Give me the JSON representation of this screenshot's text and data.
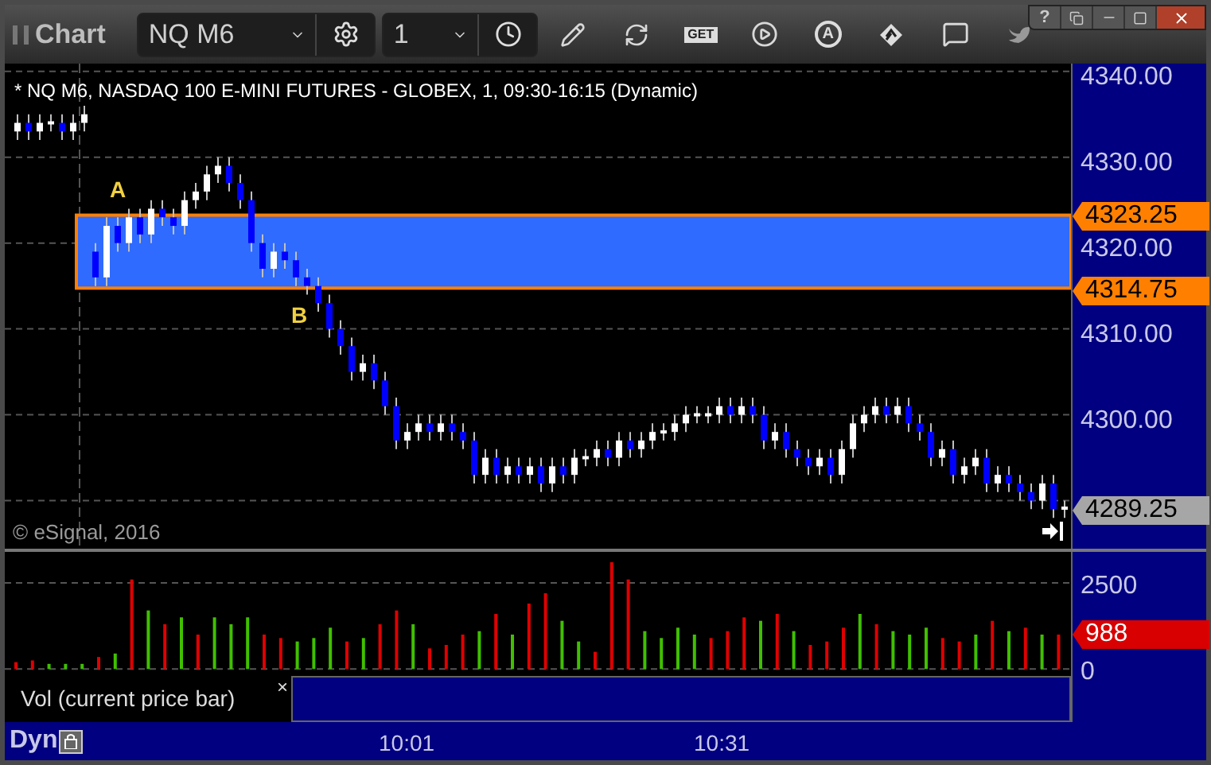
{
  "window": {
    "title": "Chart",
    "help": "?"
  },
  "toolbar": {
    "symbol": "NQ M6",
    "interval": "1",
    "get_label": "GET",
    "auto_label": "A"
  },
  "chart": {
    "title": "* NQ M6, NASDAQ 100 E-MINI FUTURES - GLOBEX, 1, 09:30-16:15 (Dynamic)",
    "copyright": "© eSignal, 2016",
    "zone_labels": [
      "A",
      "B"
    ],
    "price_tags": [
      {
        "text": "4323.25",
        "color": "#ff8000"
      },
      {
        "text": "4314.75",
        "color": "#ff8000"
      },
      {
        "text": "4289.25",
        "color": "#a6a6a6"
      }
    ],
    "chart_data": {
      "type": "candlestick",
      "ylim": [
        4284.4,
        4340.9
      ],
      "grid": true,
      "yticks": [
        {
          "value": 4340,
          "label": "4340.00"
        },
        {
          "value": 4330,
          "label": "4330.00"
        },
        {
          "value": 4320,
          "label": "4320.00"
        },
        {
          "value": 4310,
          "label": "4310.00"
        },
        {
          "value": 4300,
          "label": "4300.00"
        }
      ],
      "ohlc": [
        [
          4333,
          4335,
          4332,
          4334
        ],
        [
          4334,
          4335,
          4332,
          4333
        ],
        [
          4333,
          4335,
          4332,
          4334
        ],
        [
          4334,
          4335,
          4333,
          4334
        ],
        [
          4334,
          4335,
          4332,
          4333
        ],
        [
          4333,
          4335,
          4332,
          4334
        ],
        [
          4334,
          4336,
          4333,
          4335
        ],
        [
          4319,
          4320,
          4315,
          4316
        ],
        [
          4316,
          4323,
          4315,
          4322
        ],
        [
          4322,
          4323,
          4319,
          4320
        ],
        [
          4320,
          4324,
          4319,
          4323
        ],
        [
          4323,
          4324,
          4320,
          4321
        ],
        [
          4321,
          4325,
          4320,
          4324
        ],
        [
          4324,
          4325,
          4322,
          4323
        ],
        [
          4323,
          4324,
          4321,
          4322
        ],
        [
          4322,
          4326,
          4321,
          4325
        ],
        [
          4325,
          4327,
          4324,
          4326
        ],
        [
          4326,
          4329,
          4325,
          4328
        ],
        [
          4328,
          4330,
          4327,
          4329
        ],
        [
          4329,
          4330,
          4326,
          4327
        ],
        [
          4327,
          4328,
          4324,
          4325
        ],
        [
          4325,
          4326,
          4319,
          4320
        ],
        [
          4320,
          4321,
          4316,
          4317
        ],
        [
          4317,
          4320,
          4316,
          4319
        ],
        [
          4319,
          4320,
          4317,
          4318
        ],
        [
          4318,
          4319,
          4315,
          4316
        ],
        [
          4316,
          4317,
          4314,
          4315
        ],
        [
          4315,
          4316,
          4312,
          4313
        ],
        [
          4313,
          4314,
          4309,
          4310
        ],
        [
          4310,
          4311,
          4307,
          4308
        ],
        [
          4308,
          4309,
          4304,
          4305
        ],
        [
          4305,
          4307,
          4304,
          4306
        ],
        [
          4306,
          4307,
          4303,
          4304
        ],
        [
          4304,
          4305,
          4300,
          4301
        ],
        [
          4301,
          4302,
          4296,
          4297
        ],
        [
          4297,
          4299,
          4296,
          4298
        ],
        [
          4298,
          4300,
          4297,
          4299
        ],
        [
          4299,
          4300,
          4297,
          4298
        ],
        [
          4298,
          4300,
          4297,
          4299
        ],
        [
          4299,
          4300,
          4297,
          4298
        ],
        [
          4298,
          4299,
          4296,
          4297
        ],
        [
          4297,
          4298,
          4292,
          4293
        ],
        [
          4293,
          4296,
          4292,
          4295
        ],
        [
          4295,
          4296,
          4292,
          4293
        ],
        [
          4293,
          4295,
          4292,
          4294
        ],
        [
          4294,
          4295,
          4292,
          4293
        ],
        [
          4293,
          4295,
          4292,
          4294
        ],
        [
          4294,
          4295,
          4291,
          4292
        ],
        [
          4292,
          4295,
          4291,
          4294
        ],
        [
          4294,
          4295,
          4292,
          4293
        ],
        [
          4293,
          4296,
          4292,
          4295
        ],
        [
          4295,
          4296,
          4294,
          4295
        ],
        [
          4295,
          4297,
          4294,
          4296
        ],
        [
          4296,
          4297,
          4294,
          4295
        ],
        [
          4295,
          4298,
          4294,
          4297
        ],
        [
          4297,
          4298,
          4295,
          4296
        ],
        [
          4296,
          4298,
          4295,
          4297
        ],
        [
          4297,
          4299,
          4296,
          4298
        ],
        [
          4298,
          4299,
          4297,
          4298
        ],
        [
          4298,
          4300,
          4297,
          4299
        ],
        [
          4299,
          4301,
          4298,
          4300
        ],
        [
          4300,
          4301,
          4299,
          4300
        ],
        [
          4300,
          4301,
          4299,
          4300
        ],
        [
          4300,
          4302,
          4299,
          4301
        ],
        [
          4301,
          4302,
          4299,
          4300
        ],
        [
          4300,
          4302,
          4299,
          4301
        ],
        [
          4301,
          4302,
          4299,
          4300
        ],
        [
          4300,
          4301,
          4296,
          4297
        ],
        [
          4297,
          4299,
          4296,
          4298
        ],
        [
          4298,
          4299,
          4295,
          4296
        ],
        [
          4296,
          4297,
          4294,
          4295
        ],
        [
          4295,
          4296,
          4293,
          4294
        ],
        [
          4294,
          4296,
          4293,
          4295
        ],
        [
          4295,
          4296,
          4292,
          4293
        ],
        [
          4293,
          4297,
          4292,
          4296
        ],
        [
          4296,
          4300,
          4295,
          4299
        ],
        [
          4299,
          4301,
          4298,
          4300
        ],
        [
          4300,
          4302,
          4299,
          4301
        ],
        [
          4301,
          4302,
          4299,
          4300
        ],
        [
          4300,
          4302,
          4299,
          4301
        ],
        [
          4301,
          4302,
          4298,
          4299
        ],
        [
          4299,
          4300,
          4297,
          4298
        ],
        [
          4298,
          4299,
          4294,
          4295
        ],
        [
          4295,
          4297,
          4294,
          4296
        ],
        [
          4296,
          4297,
          4292,
          4293
        ],
        [
          4293,
          4295,
          4292,
          4294
        ],
        [
          4294,
          4296,
          4293,
          4295
        ],
        [
          4295,
          4296,
          4291,
          4292
        ],
        [
          4292,
          4294,
          4291,
          4293
        ],
        [
          4293,
          4294,
          4291,
          4292
        ],
        [
          4292,
          4293,
          4290,
          4291
        ],
        [
          4291,
          4292,
          4289,
          4290
        ],
        [
          4290,
          4293,
          4289,
          4292
        ],
        [
          4292,
          4293,
          4288,
          4289
        ],
        [
          4289,
          4290,
          4288,
          4289.25
        ]
      ]
    }
  },
  "volume": {
    "tag": {
      "text": "988",
      "color": "#d80000"
    },
    "legend": "Vol (current price bar)",
    "close_symbol": "×",
    "chart_data": {
      "type": "bar",
      "stacked": true,
      "ylim": [
        -200,
        3400
      ],
      "yticks": [
        0,
        2500
      ],
      "series": [
        {
          "color": "#e00000",
          "values": [
            200,
            250,
            null,
            null,
            null,
            350,
            null,
            2600,
            null,
            1300,
            null,
            1000,
            null,
            null,
            null,
            1000,
            900,
            null,
            null,
            null,
            800,
            null,
            1300,
            1700,
            null,
            600,
            700,
            1000,
            null,
            1600,
            null,
            1900,
            2200,
            null,
            null,
            500,
            3100,
            2600,
            null,
            null,
            null,
            null,
            900,
            1100,
            1500,
            null,
            1600,
            null,
            700,
            800,
            1200,
            null,
            1300,
            null,
            null,
            null,
            900,
            800,
            null,
            1400,
            null,
            1200,
            null,
            1000
          ]
        },
        {
          "color": "#40c000",
          "values": [
            null,
            null,
            150,
            150,
            150,
            null,
            450,
            null,
            1700,
            null,
            1500,
            null,
            1500,
            1300,
            1500,
            null,
            null,
            800,
            900,
            1200,
            null,
            900,
            null,
            null,
            1300,
            null,
            null,
            null,
            1100,
            null,
            1000,
            null,
            null,
            1400,
            800,
            null,
            null,
            null,
            1100,
            900,
            1200,
            1000,
            null,
            null,
            null,
            1400,
            null,
            1100,
            null,
            null,
            null,
            1600,
            null,
            1100,
            1000,
            1200,
            null,
            null,
            1000,
            null,
            1100,
            null,
            1000,
            null
          ]
        }
      ]
    }
  },
  "time_axis": {
    "mode": "Dyn",
    "times": [
      "10:01",
      "10:31"
    ]
  }
}
